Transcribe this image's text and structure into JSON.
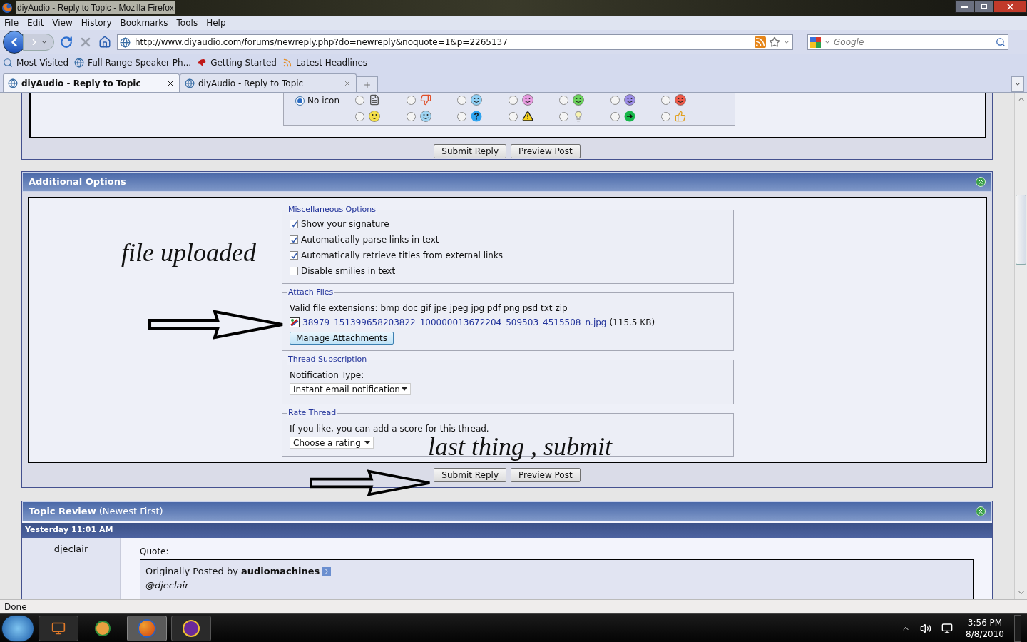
{
  "window": {
    "title": "diyAudio - Reply to Topic - Mozilla Firefox"
  },
  "menu": [
    "File",
    "Edit",
    "View",
    "History",
    "Bookmarks",
    "Tools",
    "Help"
  ],
  "address": {
    "value": "http://www.diyaudio.com/forums/newreply.php?do=newreply&noquote=1&p=2265137"
  },
  "search": {
    "placeholder": "Google"
  },
  "bookmarks": [
    {
      "label": "Most Visited",
      "kind": "folder"
    },
    {
      "label": "Full Range Speaker Ph...",
      "kind": "site"
    },
    {
      "label": "Getting Started",
      "kind": "start"
    },
    {
      "label": "Latest Headlines",
      "kind": "feed"
    }
  ],
  "tabs": [
    {
      "label": "diyAudio - Reply to Topic",
      "selected": true
    },
    {
      "label": "diyAudio - Reply to Topic",
      "selected": false
    }
  ],
  "post_icons": {
    "none_label": "No icon",
    "none_selected": true,
    "icons": [
      {
        "kind": "document",
        "selected": false
      },
      {
        "kind": "thumbs-down",
        "selected": false
      },
      {
        "kind": "wink",
        "selected": false
      },
      {
        "kind": "pink-smile",
        "selected": false
      },
      {
        "kind": "grin",
        "selected": false
      },
      {
        "kind": "frown",
        "selected": false
      },
      {
        "kind": "angry",
        "selected": false
      },
      {
        "kind": "smile",
        "selected": false
      },
      {
        "kind": "cool",
        "selected": false
      },
      {
        "kind": "question",
        "selected": false
      },
      {
        "kind": "warning",
        "selected": false
      },
      {
        "kind": "lightbulb",
        "selected": false
      },
      {
        "kind": "arrow",
        "selected": false
      },
      {
        "kind": "thumbs-up",
        "selected": false
      }
    ]
  },
  "top_buttons": [
    "Submit Reply",
    "Preview Post"
  ],
  "additional_options": {
    "title": "Additional Options",
    "misc": {
      "legend": "Miscellaneous Options",
      "options": [
        {
          "label": "Show your signature",
          "checked": true
        },
        {
          "label": "Automatically parse links in text",
          "checked": true
        },
        {
          "label": "Automatically retrieve titles from external links",
          "checked": true
        },
        {
          "label": "Disable smilies in text",
          "checked": false
        }
      ]
    },
    "attach": {
      "legend": "Attach Files",
      "extensions": "Valid file extensions: bmp doc gif jpe jpeg jpg pdf png psd txt zip",
      "file": "38979_151399658203822_100000013672204_509503_4515508_n.jpg",
      "size": "(115.5 KB)",
      "button": "Manage Attachments"
    },
    "subscription": {
      "legend": "Thread Subscription",
      "label": "Notification Type:",
      "value": "Instant email notification"
    },
    "rating": {
      "legend": "Rate Thread",
      "text": "If you like, you can add a score for this thread.",
      "value": "Choose a rating"
    },
    "buttons": [
      "Submit Reply",
      "Preview Post"
    ]
  },
  "annotations": [
    "file uploaded",
    "last thing , submit"
  ],
  "topic_review": {
    "title": "Topic Review",
    "subtitle": "(Newest First)",
    "date": "Yesterday 11:01 AM",
    "user": "djeclair",
    "quote_label": "Quote:",
    "quote_intro": "Originally Posted by **audiomachines**",
    "quote_text": "@djeclair"
  },
  "status_bar": "Done",
  "taskbar": {
    "time": "3:56 PM",
    "date": "8/8/2010"
  }
}
